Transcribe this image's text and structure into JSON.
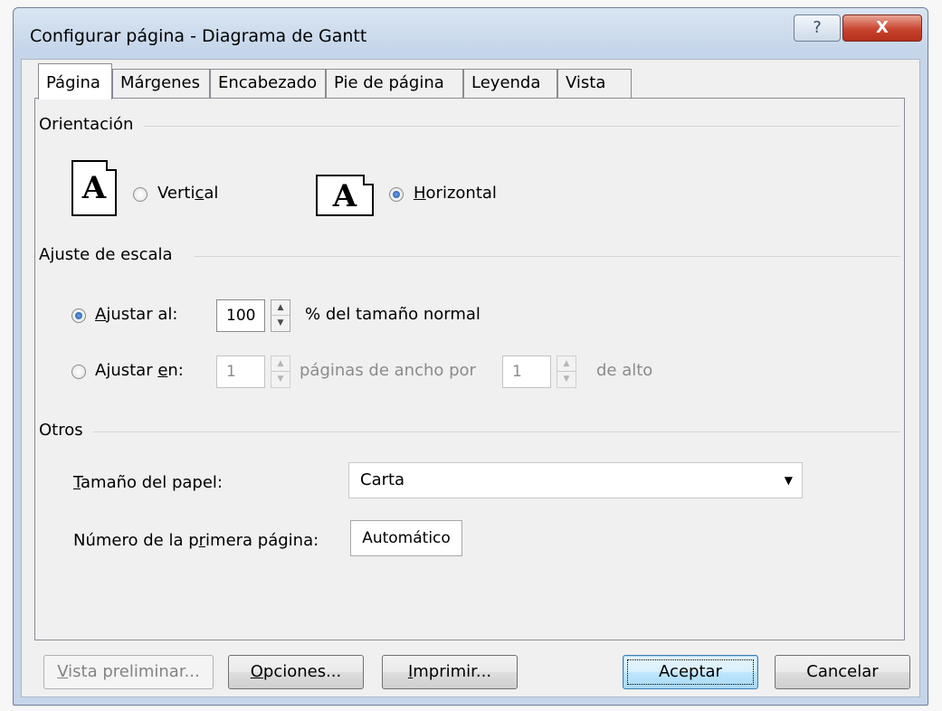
{
  "window": {
    "title": "Configurar página - Diagrama de Gantt",
    "help_label": "?",
    "close_label": "X"
  },
  "tabs": [
    {
      "label": "Página",
      "active": true
    },
    {
      "label": "Márgenes",
      "active": false
    },
    {
      "label": "Encabezado",
      "active": false
    },
    {
      "label": "Pie de página",
      "active": false
    },
    {
      "label": "Leyenda",
      "active": false
    },
    {
      "label": "Vista",
      "active": false
    }
  ],
  "orientation": {
    "title": "Orientación",
    "icon_letter": "A",
    "vertical_pre": "Verti",
    "vertical_u": "c",
    "vertical_post": "al",
    "horizontal_u": "H",
    "horizontal_post": "orizontal",
    "selected": "horizontal"
  },
  "scaling": {
    "title": "Ajuste de escala",
    "adjust_to_u": "A",
    "adjust_to_post": "justar al:",
    "adjust_to_value": "100",
    "adjust_to_suffix": "% del tamaño normal",
    "fit_to_pre": "Ajustar ",
    "fit_to_u": "e",
    "fit_to_post": "n:",
    "fit_wide_value": "1",
    "fit_wide_suffix": "páginas de ancho por",
    "fit_tall_value": "1",
    "fit_tall_suffix": "de alto",
    "selected": "adjust_to"
  },
  "other": {
    "title": "Otros",
    "paper_size_u": "T",
    "paper_size_post": "amaño del papel:",
    "paper_size_value": "Carta",
    "first_page_pre": "Número de la p",
    "first_page_u": "r",
    "first_page_post": "imera página:",
    "first_page_value": "Automático"
  },
  "buttons": {
    "preview_u": "V",
    "preview_post": "ista preliminar...",
    "options_u": "O",
    "options_post": "pciones...",
    "print_u": "I",
    "print_post": "mprimir...",
    "ok": "Aceptar",
    "cancel": "Cancelar"
  }
}
